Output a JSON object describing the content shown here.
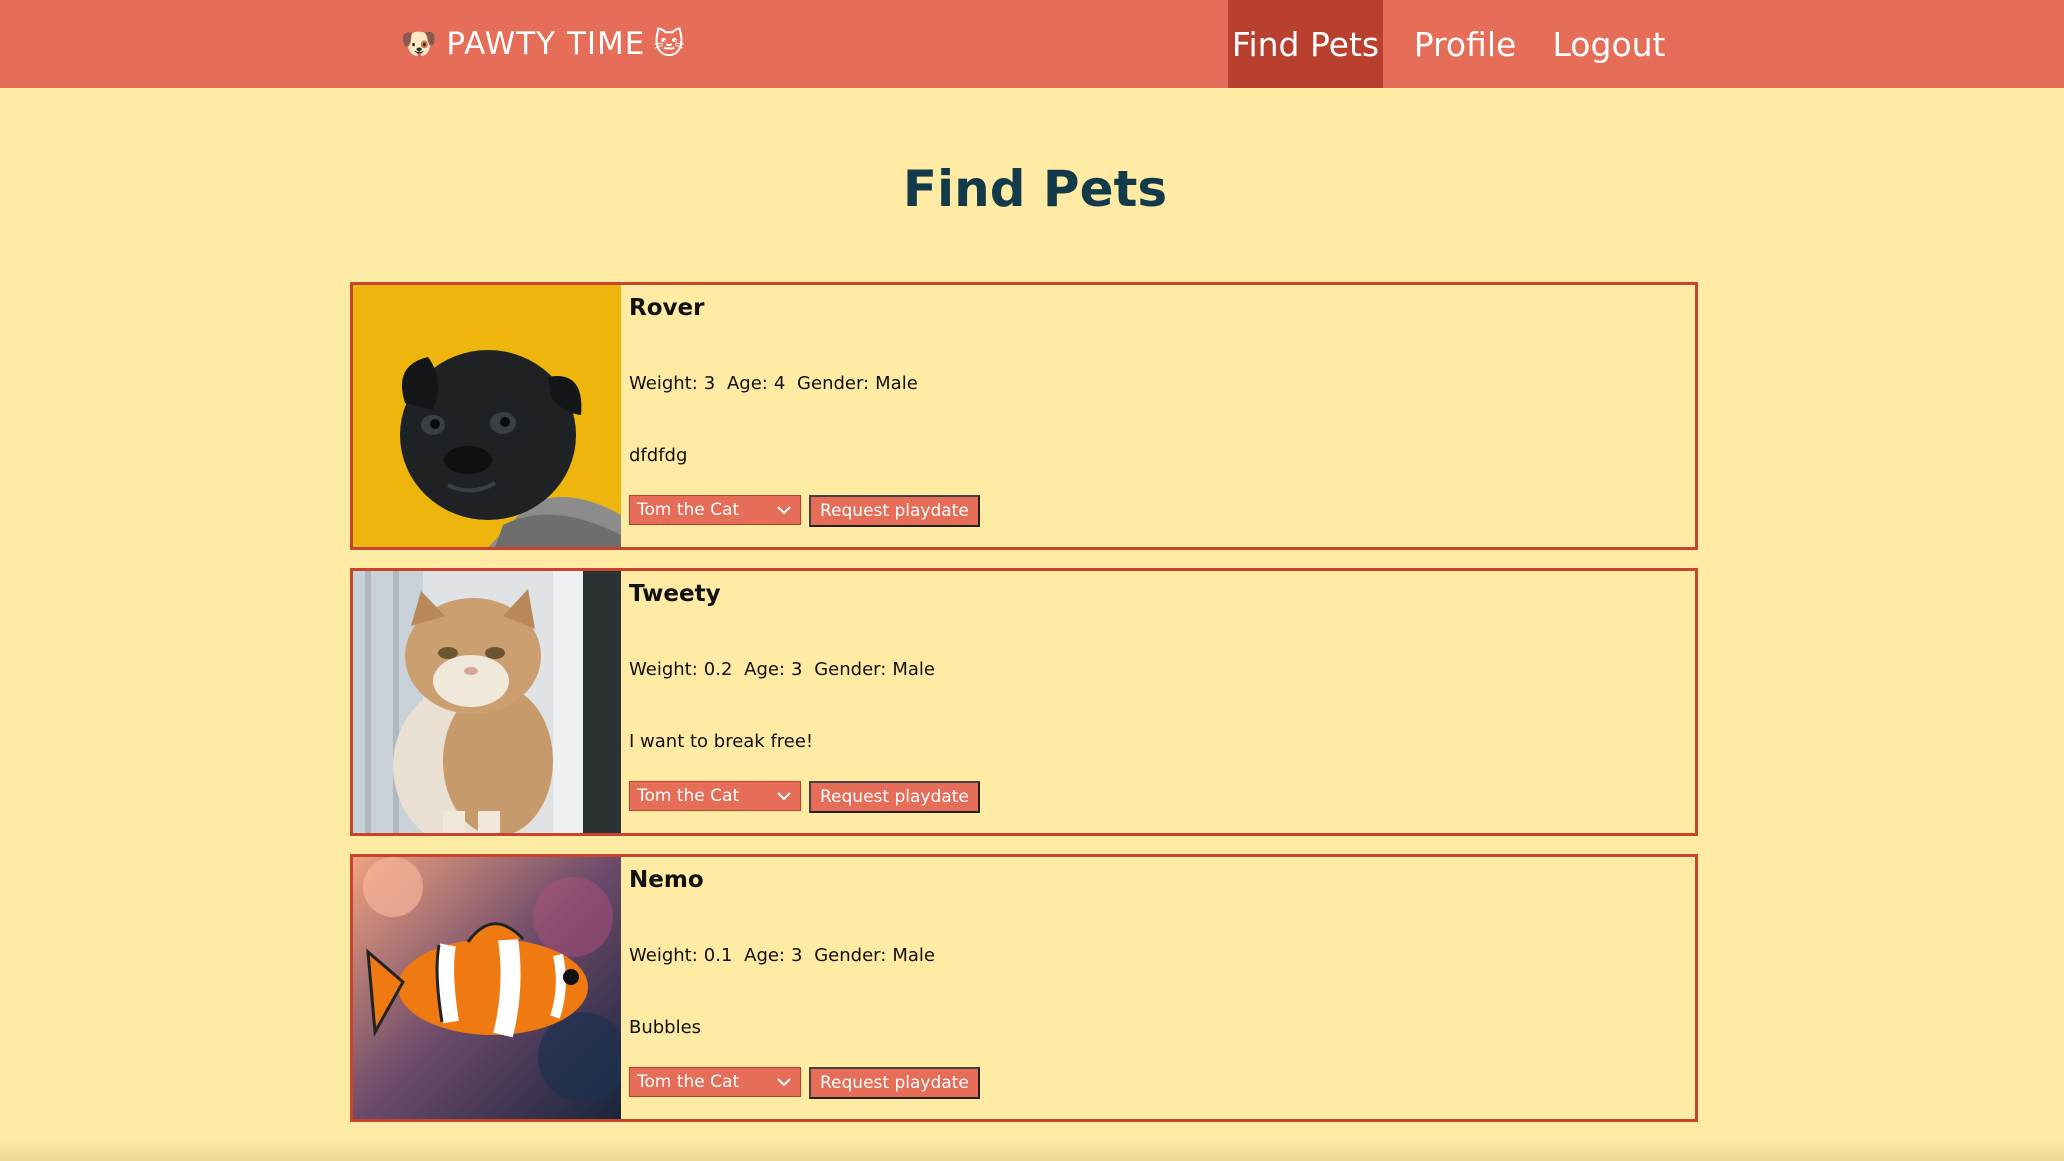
{
  "brand": {
    "left_emoji": "🐶",
    "text": "PAWTY TIME",
    "right_emoji": "🐱"
  },
  "nav": {
    "find": "Find Pets",
    "profile": "Profile",
    "logout": "Logout",
    "active": "find"
  },
  "page": {
    "title": "Find Pets"
  },
  "pets": [
    {
      "name": "Rover",
      "weight_label": "Weight:",
      "weight": "3",
      "age_label": "Age:",
      "age": "4",
      "gender_label": "Gender:",
      "gender": "Male",
      "description": "dfdfdg",
      "image": "pug-dog-photo",
      "select_value": "Tom the Cat",
      "button": "Request playdate"
    },
    {
      "name": "Tweety",
      "weight_label": "Weight:",
      "weight": "0.2",
      "age_label": "Age:",
      "age": "3",
      "gender_label": "Gender:",
      "gender": "Male",
      "description": "I want to break free!",
      "image": "persian-cat-photo",
      "select_value": "Tom the Cat",
      "button": "Request playdate"
    },
    {
      "name": "Nemo",
      "weight_label": "Weight:",
      "weight": "0.1",
      "age_label": "Age:",
      "age": "3",
      "gender_label": "Gender:",
      "gender": "Male",
      "description": "Bubbles",
      "image": "clownfish-photo",
      "select_value": "Tom the Cat",
      "button": "Request playdate"
    }
  ],
  "colors": {
    "navbar": "#e66d58",
    "nav_active": "#b9402e",
    "background": "#ffeba3",
    "card_border": "#c9442f",
    "title": "#123a4a"
  }
}
